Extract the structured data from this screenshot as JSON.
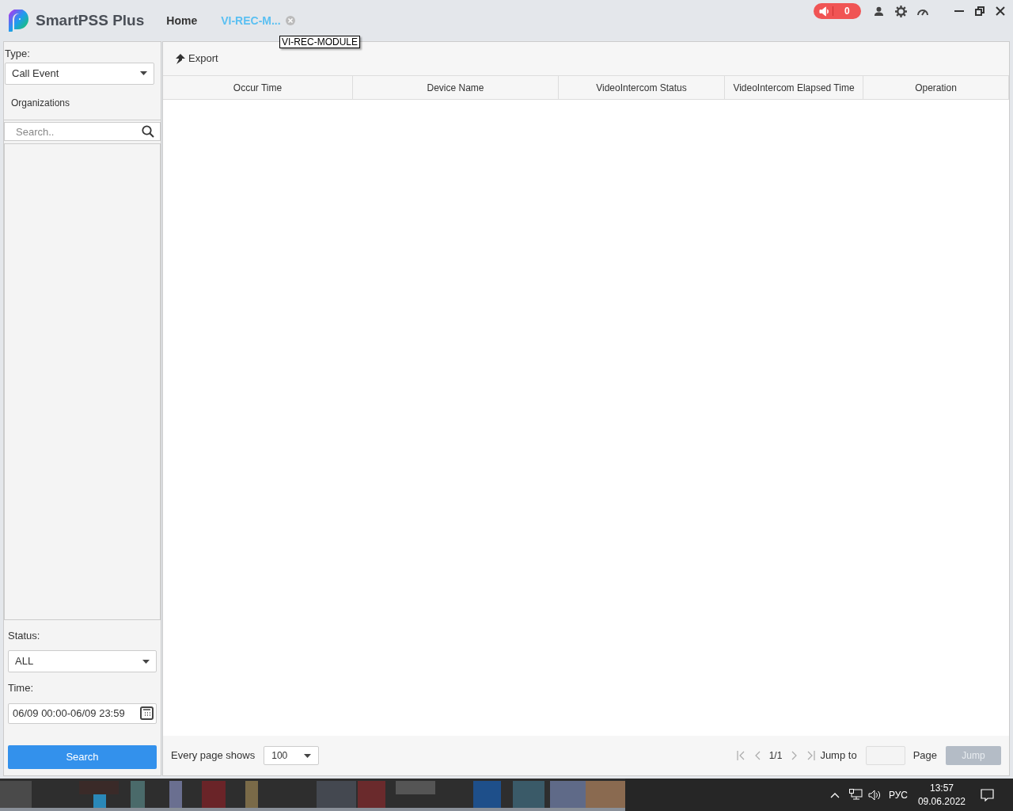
{
  "app": {
    "name": "SmartPSS Plus",
    "alarm_count": "0"
  },
  "tabs": [
    {
      "label": "Home",
      "selected": false,
      "closable": false
    },
    {
      "label": "VI-REC-M...",
      "selected": true,
      "closable": true
    }
  ],
  "tooltip": "VI-REC-MODULE",
  "sidebar": {
    "type_label": "Type:",
    "type_value": "Call Event",
    "organizations": "Organizations",
    "search_placeholder": "Search..",
    "status_label": "Status:",
    "status_value": "ALL",
    "time_label": "Time:",
    "time_value": "06/09 00:00-06/09 23:59",
    "search_button": "Search"
  },
  "toolbar": {
    "export": "Export"
  },
  "table": {
    "columns": [
      "Occur Time",
      "Device Name",
      "VideoIntercom Status",
      "VideoIntercom Elapsed Time",
      "Operation"
    ]
  },
  "pagination": {
    "per_page_label": "Every page shows",
    "per_page": "100",
    "page_info": "1/1",
    "jump_label": "Jump to",
    "page_label": "Page",
    "jump_button": "Jump",
    "jump_disabled": true
  },
  "taskbar": {
    "language": "РУС",
    "time": "13:57",
    "date": "09.06.2022"
  }
}
